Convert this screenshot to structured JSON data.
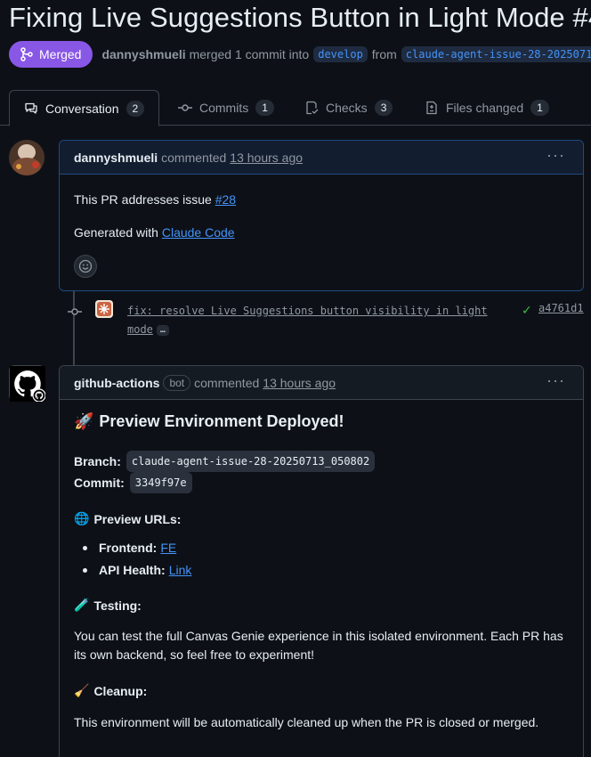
{
  "pr": {
    "title": "Fixing Live Suggestions Button in Light Mode #4",
    "status": "Merged",
    "author": "dannyshmueli",
    "merge_text": "merged 1 commit into",
    "base_branch": "develop",
    "from_text": "from",
    "head_branch": "claude-agent-issue-28-2025071"
  },
  "tabs": [
    {
      "label": "Conversation",
      "count": "2"
    },
    {
      "label": "Commits",
      "count": "1"
    },
    {
      "label": "Checks",
      "count": "3"
    },
    {
      "label": "Files changed",
      "count": "1"
    }
  ],
  "comment1": {
    "author": "dannyshmueli",
    "action": "commented",
    "time": "13 hours ago",
    "line1_prefix": "This PR addresses issue",
    "line1_link": "#28",
    "line2_prefix": "Generated with",
    "line2_link": "Claude Code"
  },
  "commit": {
    "message": "fix: resolve Live Suggestions button visibility in light mode",
    "ellipsis": "…",
    "check": "✓",
    "sha": "a4761d1"
  },
  "comment2": {
    "author": "github-actions",
    "bot_label": "bot",
    "action": "commented",
    "time": "13 hours ago",
    "heading_emoji": "🚀",
    "heading": "Preview Environment Deployed!",
    "branch_label": "Branch:",
    "branch_value": "claude-agent-issue-28-20250713_050802",
    "commit_label": "Commit:",
    "commit_value": "3349f97e",
    "urls_emoji": "🌐",
    "urls_heading": "Preview URLs:",
    "frontend_label": "Frontend:",
    "frontend_link": "FE",
    "api_label": "API Health:",
    "api_link": "Link",
    "testing_emoji": "🧪",
    "testing_heading": "Testing:",
    "testing_text": "You can test the full Canvas Genie experience in this isolated environment. Each PR has its own backend, so feel free to experiment!",
    "cleanup_emoji": "🧹",
    "cleanup_heading": "Cleanup:",
    "cleanup_text": "This environment will be automatically cleaned up when the PR is closed or merged."
  },
  "menu_dots": "···"
}
